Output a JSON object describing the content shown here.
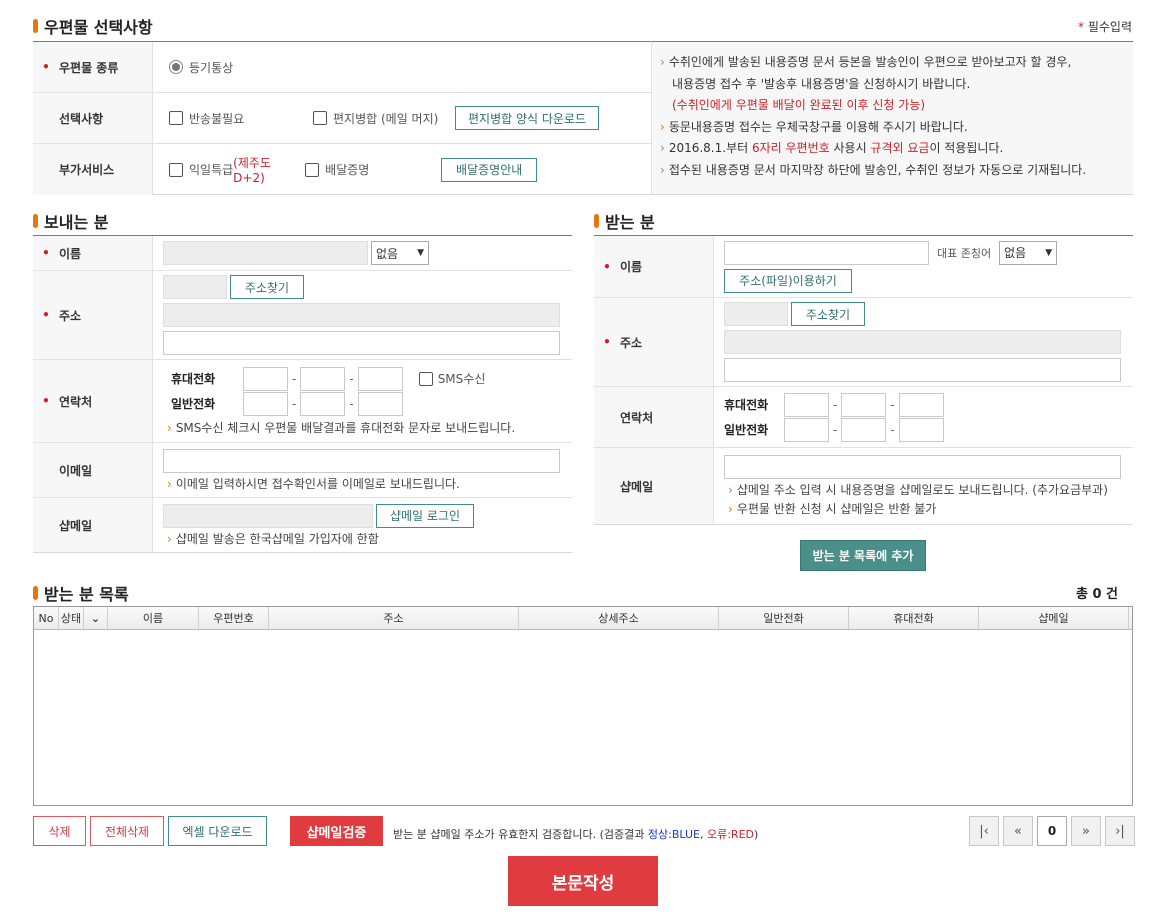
{
  "postal": {
    "title": "우편물 선택사항",
    "required_note": "필수입력",
    "type_label": "우편물 종류",
    "type_value": "등기통상",
    "options_label": "선택사항",
    "opt_no_return": "반송불필요",
    "opt_merge": "편지병합 (메일 머지)",
    "merge_download": "편지병합 양식 다운로드",
    "extra_label": "부가서비스",
    "extra_nextday": "익일특급",
    "extra_nextday_note": "(제주도 D+2)",
    "extra_delivery_proof": "배달증명",
    "delivery_guide": "배달증명안내",
    "info1a": "수취인에게 발송된 내용증명 문서 등본을 발송인이 우편으로 받아보고자 할 경우,",
    "info1b": "내용증명 접수 후 '발송후 내용증명'을 신청하시기 바랍니다.",
    "info1c": "(수취인에게 우편물 배달이 완료된 이후 신청 가능)",
    "info2": "동문내용증명 접수는 우체국창구를 이용해 주시기 바랍니다.",
    "info3a": "2016.8.1.부터 ",
    "info3b": "6자리 우편번호",
    "info3c": " 사용시 ",
    "info3d": "규격외 요금",
    "info3e": "이 적용됩니다.",
    "info4": "접수된 내용증명 문서 마지막장 하단에 발송인, 수취인 정보가 자동으로 기재됩니다."
  },
  "sender": {
    "title": "보내는 분",
    "name_label": "이름",
    "name_select": "없음",
    "addr_label": "주소",
    "addr_search": "주소찾기",
    "contact_label": "연락처",
    "mobile_label": "휴대전화",
    "phone_label": "일반전화",
    "sms_label": "SMS수신",
    "sms_note": "SMS수신 체크시 우편물 배달결과를 휴대전화 문자로 보내드립니다.",
    "email_label": "이메일",
    "email_note": "이메일 입력하시면 접수확인서를 이메일로 보내드립니다.",
    "shopmail_label": "샵메일",
    "shopmail_login": "샵메일 로그인",
    "shopmail_note": "샵메일 발송은 한국샵메일 가입자에 한함"
  },
  "receiver": {
    "title": "받는 분",
    "name_label": "이름",
    "honorific_label": "대표 존칭어",
    "honorific_select": "없음",
    "file_button": "주소(파일)이용하기",
    "addr_label": "주소",
    "addr_search": "주소찾기",
    "contact_label": "연락처",
    "mobile_label": "휴대전화",
    "phone_label": "일반전화",
    "shopmail_label": "샵메일",
    "shopmail_note1": "샵메일 주소 입력 시 내용증명을 샵메일로도 보내드립니다. (추가요금부과)",
    "shopmail_note2": "우편물 반환 신청 시 샵메일은 반환 불가",
    "add_button": "받는 분 목록에 추가"
  },
  "list": {
    "title": "받는 분 목록",
    "total": "총 0 건",
    "columns": [
      "No",
      "상태",
      "",
      "이름",
      "우편번호",
      "주소",
      "상세주소",
      "일반전화",
      "휴대전화",
      "샵메일"
    ],
    "delete": "삭제",
    "delete_all": "전체삭제",
    "excel": "엑셀 다운로드",
    "verify": "샵메일검증",
    "verify_note_a": "받는 분 샵메일 주소가 유효한지 검증합니다. (검증결과 ",
    "verify_note_blue": "정상:BLUE",
    "verify_note_sep": ", ",
    "verify_note_red": "오류:RED",
    "verify_note_end": ")",
    "page": "0",
    "submit": "본문작성"
  },
  "colors": {
    "accent_orange": "#e8760c",
    "teal": "#3f8d8c",
    "red": "#d21f26",
    "submit_red": "#e03c3f"
  }
}
